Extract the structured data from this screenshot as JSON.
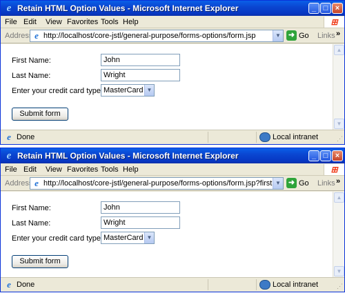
{
  "windows": [
    {
      "title": "Retain HTML Option Values - Microsoft Internet Explorer",
      "menu": [
        "File",
        "Edit",
        "View",
        "Favorites",
        "Tools",
        "Help"
      ],
      "address_label": "Address",
      "url": "http://localhost/core-jstl/general-purpose/forms-options/form.jsp",
      "go_label": "Go",
      "links_label": "Links",
      "form": {
        "first_name_label": "First Name:",
        "first_name_value": "John",
        "last_name_label": "Last Name:",
        "last_name_value": "Wright",
        "card_label": "Enter your credit card type:",
        "card_value": "MasterCard",
        "submit_label": "Submit form"
      },
      "status_text": "Done",
      "zone_text": "Local intranet"
    },
    {
      "title": "Retain HTML Option Values - Microsoft Internet Explorer",
      "menu": [
        "File",
        "Edit",
        "View",
        "Favorites",
        "Tools",
        "Help"
      ],
      "address_label": "Address",
      "url": "http://localhost/core-jstl/general-purpose/forms-options/form.jsp?firstName=John&last",
      "go_label": "Go",
      "links_label": "Links",
      "form": {
        "first_name_label": "First Name:",
        "first_name_value": "John",
        "last_name_label": "Last Name:",
        "last_name_value": "Wright",
        "card_label": "Enter your credit card type:",
        "card_value": "MasterCard",
        "submit_label": "Submit form"
      },
      "status_text": "Done",
      "zone_text": "Local intranet"
    }
  ]
}
